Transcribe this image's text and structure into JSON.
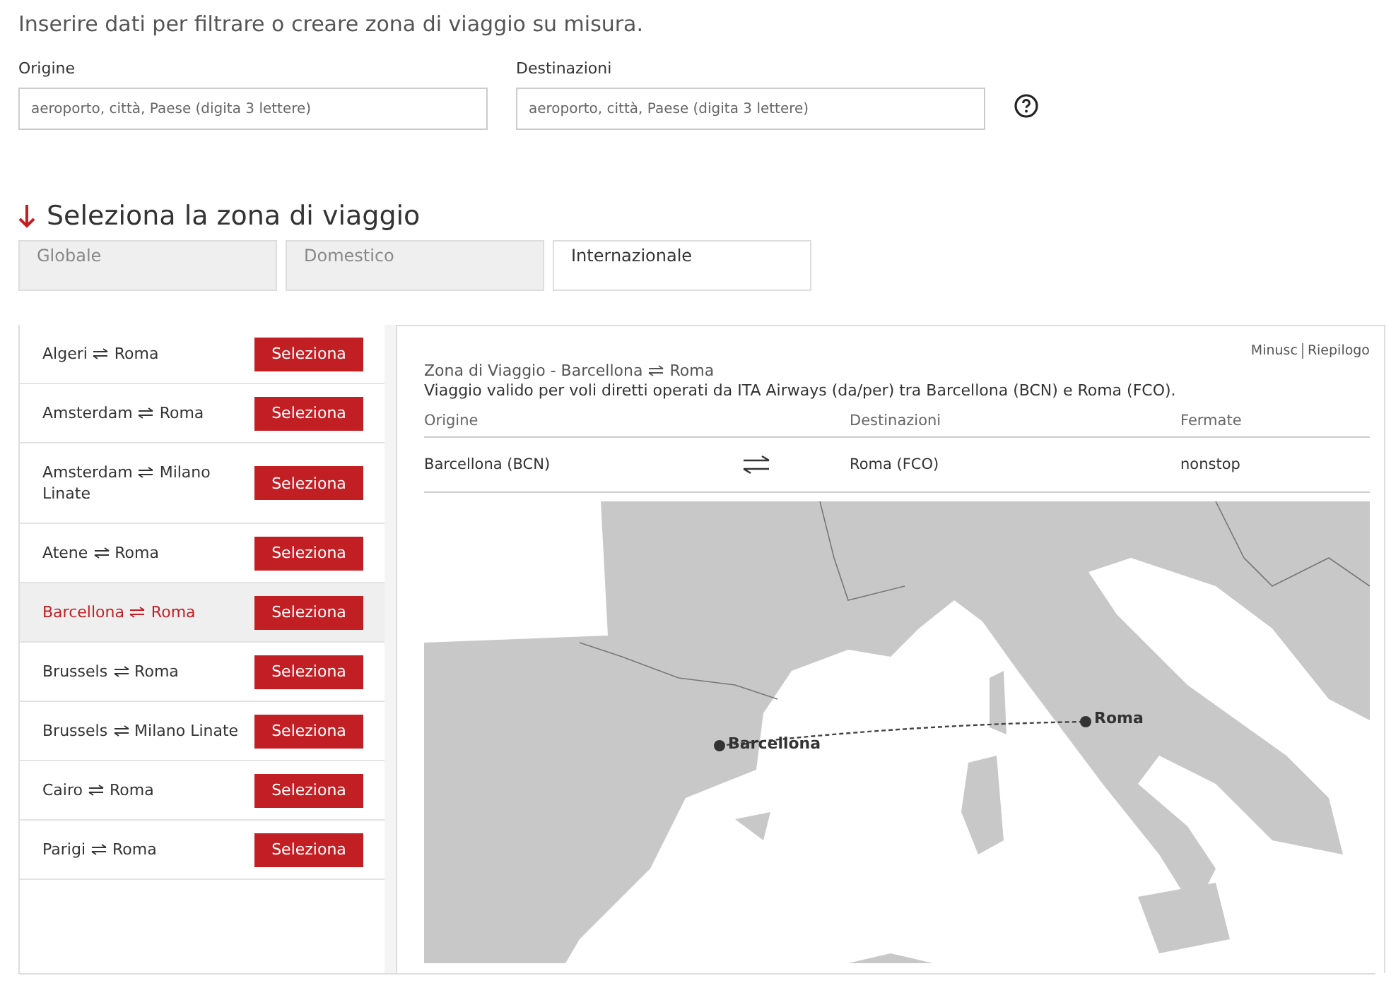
{
  "intro": "Inserire dati per filtrare o creare zona di viaggio su misura.",
  "filters": [
    {
      "label": "Origine",
      "placeholder": "aeroporto, città, Paese (digita 3 lettere)"
    },
    {
      "label": "Destinazioni",
      "placeholder": "aeroporto, città, Paese (digita 3 lettere)"
    }
  ],
  "section_title": "Seleziona la zona di viaggio",
  "tabs": [
    {
      "label": "Globale",
      "selected": false
    },
    {
      "label": "Domestico",
      "selected": false
    },
    {
      "label": "Internazionale",
      "selected": true
    }
  ],
  "routes": [
    {
      "from": "Algeri",
      "to": "Roma",
      "selected": false,
      "button": "Seleziona"
    },
    {
      "from": "Amsterdam",
      "to": "Roma",
      "selected": false,
      "button": "Seleziona"
    },
    {
      "from": "Amsterdam",
      "to": "Milano Linate",
      "selected": false,
      "button": "Seleziona"
    },
    {
      "from": "Atene",
      "to": "Roma",
      "selected": false,
      "button": "Seleziona"
    },
    {
      "from": "Barcellona",
      "to": "Roma",
      "selected": true,
      "button": "Seleziona"
    },
    {
      "from": "Brussels",
      "to": "Roma",
      "selected": false,
      "button": "Seleziona"
    },
    {
      "from": "Brussels",
      "to": "Milano Linate",
      "selected": false,
      "button": "Seleziona"
    },
    {
      "from": "Cairo",
      "to": "Roma",
      "selected": false,
      "button": "Seleziona"
    },
    {
      "from": "Parigi",
      "to": "Roma",
      "selected": false,
      "button": "Seleziona"
    }
  ],
  "detail": {
    "links": [
      "Minusc",
      "Riepilogo"
    ],
    "title_prefix": "Zona di Viaggio - ",
    "from": "Barcellona",
    "to": "Roma",
    "description": "Viaggio valido per voli diretti operati da ITA Airways (da/per) tra Barcellona (BCN) e Roma (FCO).",
    "columns": [
      "Origine",
      "Destinazioni",
      "Fermate"
    ],
    "row": {
      "origin": "Barcellona (BCN)",
      "destination": "Roma (FCO)",
      "stops": "nonstop"
    },
    "map_markers": [
      "Barcellona",
      "Roma"
    ]
  }
}
